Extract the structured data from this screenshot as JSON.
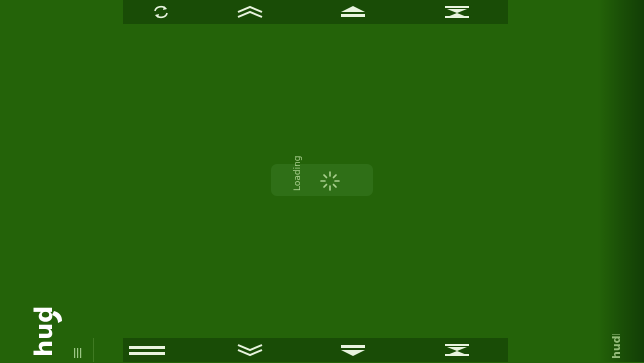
{
  "app": {
    "loading_text": "Loading",
    "logo_text": "hud!"
  },
  "toolbar_top": {
    "buttons": [
      {
        "icon": "refresh-icon"
      },
      {
        "icon": "chevron-up-icon"
      },
      {
        "icon": "triangle-up-icon"
      },
      {
        "icon": "collapse-icon"
      }
    ]
  },
  "toolbar_bottom": {
    "buttons": [
      {
        "icon": "menu-icon"
      },
      {
        "icon": "chevron-down-icon"
      },
      {
        "icon": "triangle-down-icon"
      },
      {
        "icon": "expand-icon"
      }
    ]
  },
  "colors": {
    "background": "#246309",
    "toolbar": "#194c06",
    "icon": "#e8f4de",
    "loading_box": "#2f6f17"
  }
}
